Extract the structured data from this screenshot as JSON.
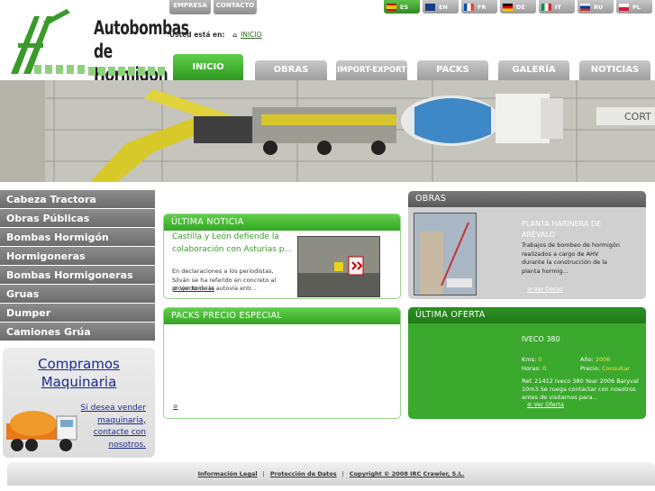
{
  "brand": {
    "line1": "Autobombas",
    "line2": "de Hormigon",
    "logo_letter": "AH"
  },
  "top_links": [
    "EMPRESA",
    "CONTACTO"
  ],
  "breadcrumb": {
    "label": "Usted está en:",
    "link": "INICIO"
  },
  "languages": [
    {
      "code": "ES",
      "active": true
    },
    {
      "code": "EN",
      "active": false
    },
    {
      "code": "FR",
      "active": false
    },
    {
      "code": "DE",
      "active": false
    },
    {
      "code": "IT",
      "active": false
    },
    {
      "code": "RU",
      "active": false
    },
    {
      "code": "PL",
      "active": false
    }
  ],
  "nav": [
    "INICIO",
    "OBRAS",
    "IMPORT-EXPORT",
    "PACKS",
    "GALERÍA",
    "NOTICIAS"
  ],
  "menu": [
    "Cabeza Tractora",
    "Obras Públicas",
    "Bombas Hormigón",
    "Hormigoneras",
    "Bombas Hormigoneras",
    "Gruas",
    "Dumper",
    "Camiones Grúa"
  ],
  "buy": {
    "title": "Compramos Maquinaria",
    "text": "Si desea vender maquinaria, contacte con nosotros."
  },
  "news": {
    "heading": "ÚLTIMA NOTICIA",
    "title": "Castilla y León defiende la colaboración con Asturias p...",
    "text": "En declaraciones a los periodistas, Silván se ha referido en concreto al proyecto de la autovía entr...",
    "more": "Ver Noticias"
  },
  "obras": {
    "heading": "OBRAS",
    "title": "PLANTA HARINERA DE ARÉVALO",
    "text": "Trabajos de bombeo de hormigón realizados a cargo de AHV durante la construcción de la planta hormig...",
    "more": "Ver Obras"
  },
  "packs": {
    "heading": "PACKS PRECIO ESPECIAL"
  },
  "oferta": {
    "heading": "ÚLTIMA OFERTA",
    "model": "IVECO 380",
    "kms_label": "Kms:",
    "kms_value": "0",
    "year_label": "Año:",
    "year_value": "2006",
    "hours_label": "Horas:",
    "hours_value": "0",
    "price_label": "Precio:",
    "price_value": "Consultar",
    "text": "Ref. 21412 Iveco 380 Year 2006 Baryval 10m3 Se ruega contactar con nosotros antes de visitarnos para...",
    "more": "Ver Oferta"
  },
  "footer": [
    "Información Legal",
    "Protección de Datos",
    "Copyright © 2008 IRC Crawler, S.L."
  ],
  "colors": {
    "green": "#3aa92d",
    "gray": "#7a7a7a",
    "link_blue": "#1b2a8a"
  }
}
